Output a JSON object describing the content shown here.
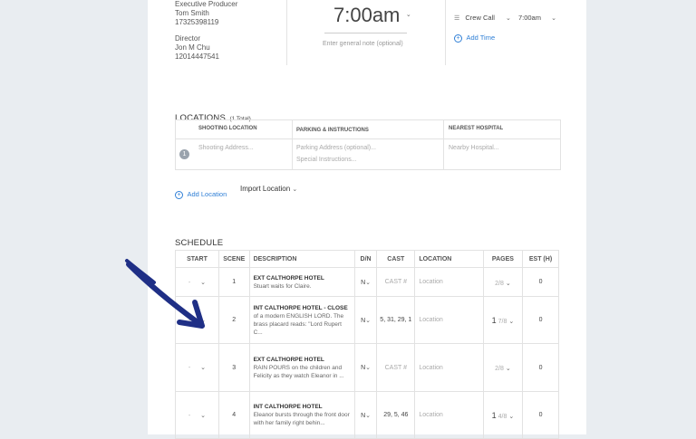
{
  "contacts": [
    {
      "role": "Executive Producer",
      "name": "Tom Smith",
      "phone": "17325398119"
    },
    {
      "role": "Director",
      "name": "Jon M Chu",
      "phone": "12014447541"
    }
  ],
  "time": {
    "value": "7:00am",
    "note_placeholder": "Enter general note (optional)"
  },
  "call": {
    "label": "Crew Call",
    "time": "7:00am",
    "add_time": "Add Time"
  },
  "locations": {
    "title": "LOCATIONS",
    "count": "(1 Total)",
    "headers": [
      "SHOOTING LOCATION",
      "PARKING & INSTRUCTIONS",
      "NEAREST HOSPITAL"
    ],
    "row_number": "1",
    "shooting_placeholder": "Shooting Address...",
    "parking_placeholder": "Parking Address (optional)...",
    "special_placeholder": "Special Instructions...",
    "hospital_placeholder": "Nearby Hospital...",
    "add_location": "Add Location",
    "import_location": "Import Location"
  },
  "schedule": {
    "title": "SCHEDULE",
    "headers": [
      "START",
      "SCENE",
      "DESCRIPTION",
      "D/N",
      "CAST",
      "LOCATION",
      "PAGES",
      "EST (H)"
    ],
    "rows": [
      {
        "start": "-",
        "scene": "1",
        "title": "EXT CALTHORPE HOTEL",
        "desc": "Stuart waits for Claire.",
        "dn": "N",
        "cast": "CAST #",
        "location": "Location",
        "pages_whole": "",
        "pages_frac": "2/8",
        "est": "0"
      },
      {
        "start": "-",
        "scene": "2",
        "title": "INT CALTHORPE HOTEL - CLOSE",
        "desc": "of a modern ENGLISH LORD. The brass placard reads: \"Lord Rupert C...",
        "dn": "N",
        "cast": "5, 31, 29, 1",
        "location": "Location",
        "pages_whole": "1",
        "pages_frac": "7/8",
        "est": "0"
      },
      {
        "start": "-",
        "scene": "3",
        "title": "EXT CALTHORPE HOTEL",
        "desc": "RAIN POURS on the children and Felicity as they watch Eleanor in ...",
        "dn": "N",
        "cast": "CAST #",
        "location": "Location",
        "pages_whole": "",
        "pages_frac": "2/8",
        "est": "0"
      },
      {
        "start": "-",
        "scene": "4",
        "title": "INT CALTHORPE HOTEL",
        "desc": "Eleanor bursts through the front door with her family right behin...",
        "dn": "N",
        "cast": "29, 5, 46",
        "location": "Location",
        "pages_whole": "1",
        "pages_frac": "4/8",
        "est": "0"
      }
    ]
  },
  "colors": {
    "accent": "#2f7fd6",
    "arrow": "#1f2f86",
    "background": "#e9edf1"
  }
}
